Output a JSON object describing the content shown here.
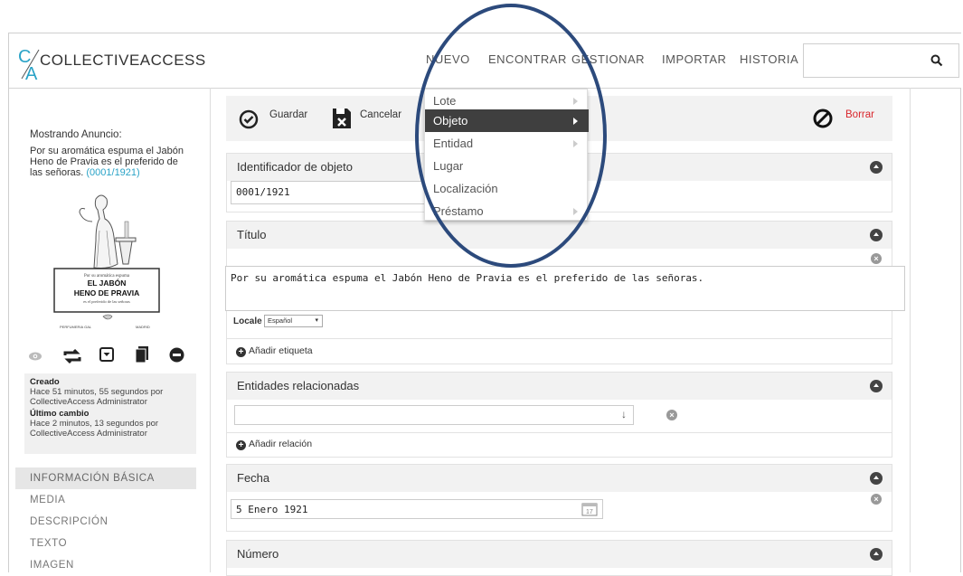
{
  "header": {
    "logo_ca": "CA",
    "logo_text": "COLLECTIVEACCESS",
    "nav": [
      "NUEVO",
      "ENCONTRAR",
      "GESTIONAR",
      "IMPORTAR",
      "HISTORIA"
    ],
    "search_placeholder": "",
    "search_icon": "search-icon"
  },
  "sidebar": {
    "showing_label": "Mostrando Anuncio:",
    "title": "Por su aromática espuma el Jabón Heno de Pravia es el preferido de las señoras.",
    "id": "(0001/1921)",
    "thumb": {
      "line1": "Por su aromática espuma",
      "line2": "EL JABÓN",
      "line3": "HENO DE PRAVIA",
      "line4": "es el preferido de las señoras",
      "maker": "PERFUMERIA GAL",
      "city": "MADRID"
    },
    "tools": [
      "eye-icon",
      "repeat-icon",
      "dropdown-box-icon",
      "copy-icon",
      "minus-circle-icon"
    ],
    "created_label": "Creado",
    "created_text": "Hace 51 minutos, 55 segundos por CollectiveAccess Administrator",
    "changed_label": "Último cambio",
    "changed_text": "Hace 2 minutos, 13 segundos por CollectiveAccess Administrator",
    "nav": [
      "INFORMACIÓN BÁSICA",
      "MEDIA",
      "DESCRIPCIÓN",
      "TEXTO",
      "IMAGEN"
    ]
  },
  "toolbar": {
    "save_label": "Guardar",
    "cancel_label": "Cancelar",
    "delete_label": "Borrar"
  },
  "bundles": {
    "identifier": {
      "title": "Identificador de objeto",
      "value": "0001/1921"
    },
    "title": {
      "title": "Título",
      "value": "Por su aromática espuma el Jabón Heno de Pravia es el preferido de las señoras.",
      "locale_label": "Locale",
      "locale_value": "Español",
      "add_label": "Añadir etiqueta"
    },
    "entities": {
      "title": "Entidades relacionadas",
      "value": "",
      "add_label": "Añadir relación"
    },
    "date": {
      "title": "Fecha",
      "value": "5 Enero 1921"
    },
    "number": {
      "title": "Número"
    }
  },
  "dropdown": {
    "items": [
      {
        "label": "Lote",
        "submenu": true,
        "active": false
      },
      {
        "label": "Objeto",
        "submenu": true,
        "active": true
      },
      {
        "label": "Entidad",
        "submenu": true,
        "active": false
      },
      {
        "label": "Lugar",
        "submenu": false,
        "active": false
      },
      {
        "label": "Localización",
        "submenu": false,
        "active": false
      },
      {
        "label": "Préstamo",
        "submenu": true,
        "active": false
      }
    ]
  },
  "colors": {
    "accent_blue": "#2aa3c7",
    "delete_red": "#d9262c",
    "annotation_ellipse": "#2c4a7c",
    "menu_active_bg": "#3f3f3f"
  }
}
